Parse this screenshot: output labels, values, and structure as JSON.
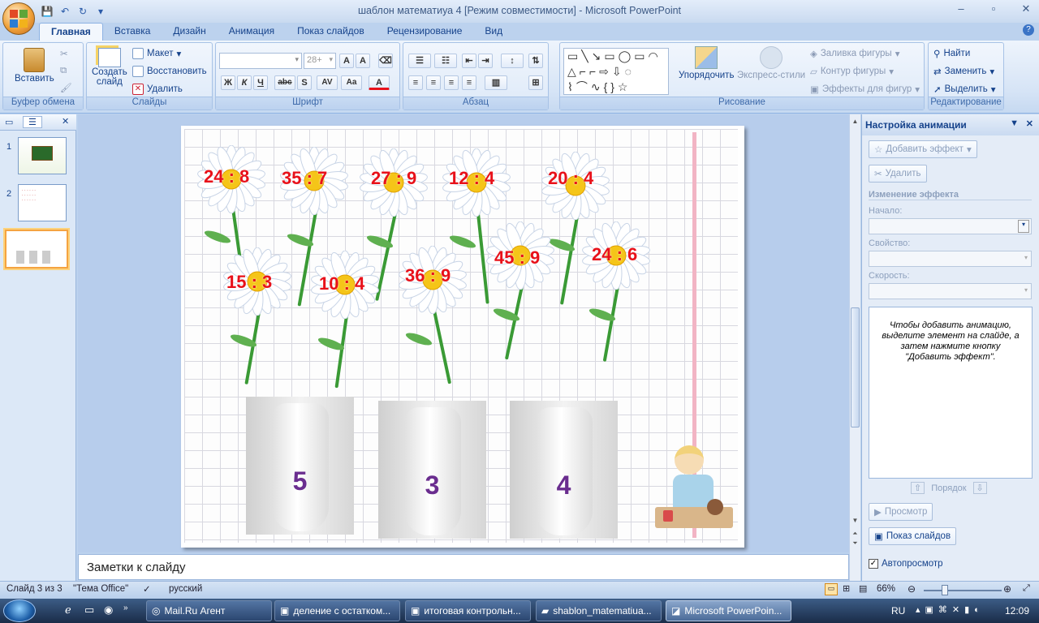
{
  "window": {
    "title": "шаблон математиуа 4 [Режим совместимости] - Microsoft PowerPoint"
  },
  "ribbon": {
    "tabs": [
      "Главная",
      "Вставка",
      "Дизайн",
      "Анимация",
      "Показ слайдов",
      "Рецензирование",
      "Вид"
    ],
    "active_tab": "Главная",
    "groups": {
      "clipboard": {
        "label": "Буфер обмена",
        "paste": "Вставить"
      },
      "slides": {
        "label": "Слайды",
        "new_slide_1": "Создать",
        "new_slide_2": "слайд",
        "layout": "Макет",
        "reset": "Восстановить",
        "delete": "Удалить"
      },
      "font": {
        "label": "Шрифт",
        "size": "28+",
        "bold": "Ж",
        "italic": "К",
        "underline": "Ч",
        "strike": "abc",
        "shadow": "S",
        "spacing": "AV",
        "case": "Aa",
        "color": "A"
      },
      "paragraph": {
        "label": "Абзац"
      },
      "drawing": {
        "label": "Рисование",
        "arrange": "Упорядочить",
        "quick_styles": "Экспресс-стили",
        "fill": "Заливка фигуры",
        "outline": "Контур фигуры",
        "effects": "Эффекты для фигур"
      },
      "editing": {
        "label": "Редактирование",
        "find": "Найти",
        "replace": "Заменить",
        "select": "Выделить"
      }
    }
  },
  "slides_pane": {
    "numbers": [
      "1",
      "2",
      "3"
    ],
    "active": 3
  },
  "slide": {
    "flowers": [
      {
        "expr": "24 : 8"
      },
      {
        "expr": "35 : 7"
      },
      {
        "expr": "27 : 9"
      },
      {
        "expr": "12 : 4"
      },
      {
        "expr": "20 : 4"
      },
      {
        "expr": "15 : 3"
      },
      {
        "expr": "10 : 4"
      },
      {
        "expr": "36 : 9"
      },
      {
        "expr": "45 : 9"
      },
      {
        "expr": "24 : 6"
      }
    ],
    "vases": [
      "5",
      "3",
      "4"
    ]
  },
  "notes": {
    "placeholder": "Заметки к слайду"
  },
  "task_pane": {
    "title": "Настройка анимации",
    "add_effect": "Добавить эффект",
    "remove": "Удалить",
    "change_effect": "Изменение эффекта",
    "start_label": "Начало:",
    "property_label": "Свойство:",
    "speed_label": "Скорость:",
    "info": "Чтобы добавить анимацию, выделите элемент на слайде, а затем нажмите кнопку \"Добавить эффект\".",
    "order": "Порядок",
    "play": "Просмотр",
    "slideshow": "Показ слайдов",
    "autopreview": "Автопросмотр"
  },
  "status": {
    "slide": "Слайд 3 из 3",
    "theme": "\"Тема Office\"",
    "language": "русский",
    "zoom": "66%"
  },
  "taskbar": {
    "items": [
      "Mail.Ru Агент",
      "деление с остатком...",
      "итоговая контрольн...",
      "shablon_matematiua...",
      "Microsoft PowerPoin..."
    ],
    "lang": "RU",
    "time": "12:09"
  },
  "colors": {
    "expr": "#e8111a",
    "vase_num": "#6a2d8f",
    "accent": "#15428b"
  }
}
